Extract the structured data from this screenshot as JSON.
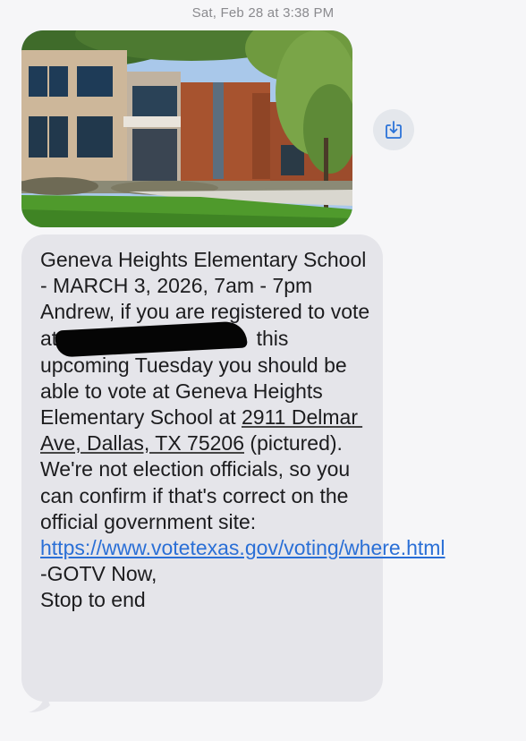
{
  "header": {
    "date": "Sat, Feb 28",
    "at": "at",
    "time": "3:38 PM"
  },
  "attachment": {
    "icon": "square-and-arrow-down-icon",
    "image_subject": "school building"
  },
  "message": {
    "line_title": "Geneva Heights Elementary School - MARCH 3, 2026, 7am - 7pm",
    "part1": "Andrew, if you are registered to vote at",
    "redacted": "[redacted]",
    "part2": " this upcoming Tuesday you should be able to vote at Geneva Heights Elementary School at ",
    "address": "2911 Delmar Ave, Dallas, TX 75206",
    "part3": " (pictured). We're not election officials, so you can confirm if that's correct on the official government site: ",
    "link": "https://www.votetexas.gov/voting/where.html",
    "signoff": "-GOTV Now,",
    "stop": "Stop to end"
  },
  "colors": {
    "bubble": "#e5e5ea",
    "link": "#2a6fd6",
    "background": "#f6f6f8",
    "timestamp": "#8a8a8e"
  }
}
